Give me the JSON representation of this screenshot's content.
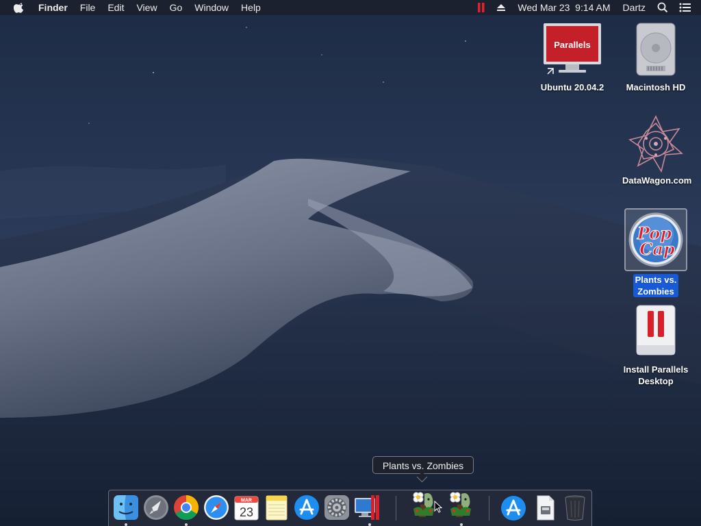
{
  "menubar": {
    "apple_icon": "apple-icon",
    "app_name": "Finder",
    "menus": [
      "File",
      "Edit",
      "View",
      "Go",
      "Window",
      "Help"
    ],
    "clock": "Wed Mar 23  9:14 AM",
    "user": "Dartz",
    "status_icons": [
      "parallels-status-icon",
      "eject-icon",
      "spotlight-search-icon",
      "notification-center-icon"
    ]
  },
  "desktop": {
    "icons": [
      {
        "label": "Ubuntu 20.04.2",
        "icon": "parallels-vm-icon",
        "badge": "Parallels",
        "alias": true
      },
      {
        "label": "Macintosh HD",
        "icon": "hard-drive-icon"
      },
      {
        "label": "DataWagon.com",
        "icon": "datawagon-icon"
      },
      {
        "label_line1": "Plants vs.",
        "label_line2": "Zombies",
        "icon": "popcap-icon",
        "badge_line1": "Pop",
        "badge_line2": "Cap",
        "selected": true
      },
      {
        "label_line1": "Install Parallels",
        "label_line2": "Desktop",
        "icon": "parallels-installer-icon"
      }
    ]
  },
  "tooltip": {
    "text": "Plants vs. Zombies"
  },
  "dock": {
    "items": [
      "finder-icon",
      "launchpad-icon",
      "chrome-icon",
      "safari-icon",
      "calendar-icon",
      "notes-icon",
      "app-store-icon",
      "system-preferences-icon",
      "parallels-desktop-icon",
      "plants-vs-zombies-icon",
      "plants-vs-zombies-icon",
      "app-store-downloads-icon",
      "document-icon",
      "trash-icon"
    ],
    "calendar": {
      "month": "MAR",
      "day": "23"
    }
  }
}
